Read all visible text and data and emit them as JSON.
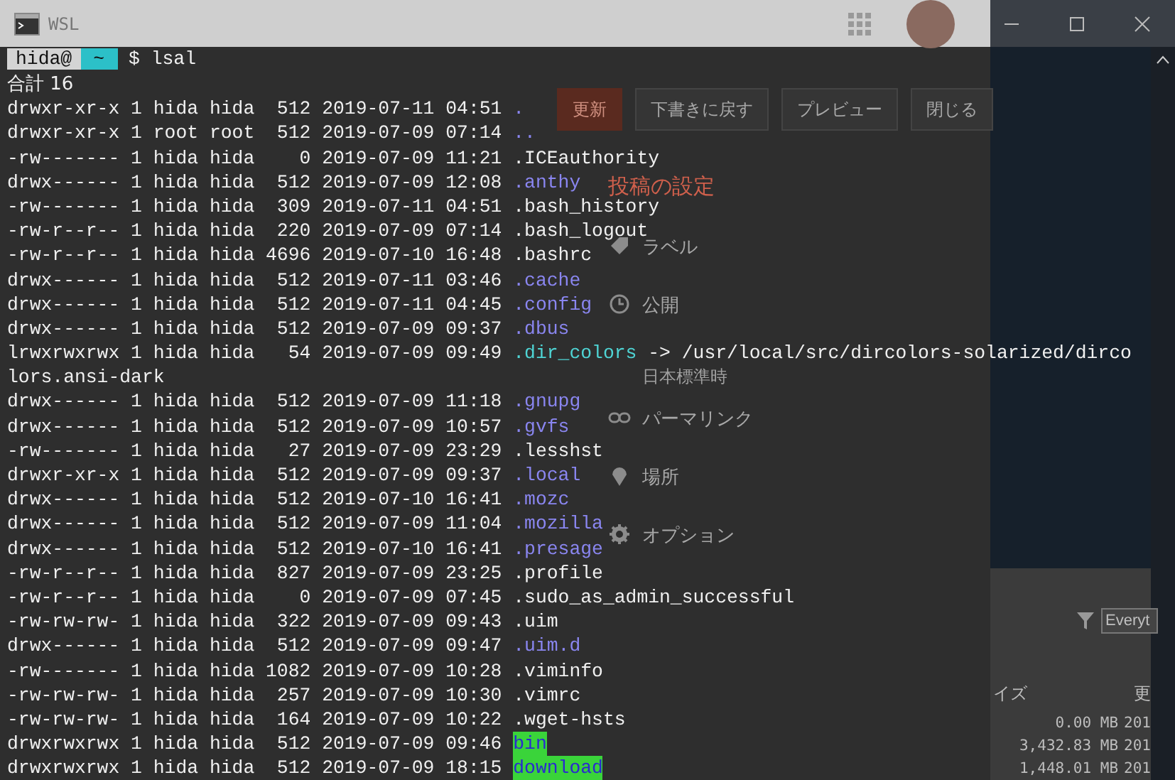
{
  "window": {
    "title": "WSL"
  },
  "background_editor": {
    "buttons": [
      {
        "label": "更新",
        "kind": "primary"
      },
      {
        "label": "下書きに戻す",
        "kind": "normal"
      },
      {
        "label": "プレビュー",
        "kind": "normal"
      },
      {
        "label": "閉じる",
        "kind": "normal"
      }
    ],
    "settings_heading": "投稿の設定",
    "settings": [
      {
        "kind": "labels",
        "label": "ラベル"
      },
      {
        "kind": "schedule",
        "label": "公開",
        "detail": "日本標準時"
      },
      {
        "kind": "permalink",
        "label": "パーマリンク"
      },
      {
        "kind": "location",
        "label": "場所"
      },
      {
        "kind": "options",
        "label": "オプション"
      }
    ]
  },
  "background_file_window": {
    "search_placeholder": "Everyt",
    "columns": [
      "イズ",
      "更"
    ],
    "rows": [
      {
        "size": "0.00 MB",
        "date": "201"
      },
      {
        "size": "3,432.83 MB",
        "date": "201"
      },
      {
        "size": "1,448.01 MB",
        "date": "201"
      }
    ]
  },
  "terminal": {
    "prompt": {
      "user": "hida@",
      "dir": "~",
      "command": "$ lsal"
    },
    "lines": [
      {
        "kind": "total",
        "text": "合計 16"
      },
      {
        "kind": "dir",
        "info": "drwxr-xr-x 1 hida hida  512 2019-07-11 04:51",
        "name": "."
      },
      {
        "kind": "dir",
        "info": "drwxr-xr-x 1 root root  512 2019-07-09 07:14",
        "name": ".."
      },
      {
        "kind": "file",
        "info": "-rw------- 1 hida hida    0 2019-07-09 11:21",
        "name": ".ICEauthority"
      },
      {
        "kind": "dir",
        "info": "drwx------ 1 hida hida  512 2019-07-09 12:08",
        "name": ".anthy"
      },
      {
        "kind": "file",
        "info": "-rw------- 1 hida hida  309 2019-07-11 04:51",
        "name": ".bash_history"
      },
      {
        "kind": "file",
        "info": "-rw-r--r-- 1 hida hida  220 2019-07-09 07:14",
        "name": ".bash_logout"
      },
      {
        "kind": "file",
        "info": "-rw-r--r-- 1 hida hida 4696 2019-07-10 16:48",
        "name": ".bashrc"
      },
      {
        "kind": "dir",
        "info": "drwx------ 1 hida hida  512 2019-07-11 03:46",
        "name": ".cache"
      },
      {
        "kind": "dir",
        "info": "drwx------ 1 hida hida  512 2019-07-11 04:45",
        "name": ".config"
      },
      {
        "kind": "dir",
        "info": "drwx------ 1 hida hida  512 2019-07-09 09:37",
        "name": ".dbus"
      },
      {
        "kind": "link",
        "info": "lrwxrwxrwx 1 hida hida   54 2019-07-09 09:49",
        "name": ".dir_colors",
        "target": "-> /usr/local/src/dircolors-solarized/dirco"
      },
      {
        "kind": "continuation",
        "text": "lors.ansi-dark"
      },
      {
        "kind": "dir",
        "info": "drwx------ 1 hida hida  512 2019-07-09 11:18",
        "name": ".gnupg"
      },
      {
        "kind": "dir",
        "info": "drwx------ 1 hida hida  512 2019-07-09 10:57",
        "name": ".gvfs"
      },
      {
        "kind": "file",
        "info": "-rw------- 1 hida hida   27 2019-07-09 23:29",
        "name": ".lesshst"
      },
      {
        "kind": "dir",
        "info": "drwxr-xr-x 1 hida hida  512 2019-07-09 09:37",
        "name": ".local"
      },
      {
        "kind": "dir",
        "info": "drwx------ 1 hida hida  512 2019-07-10 16:41",
        "name": ".mozc"
      },
      {
        "kind": "dir",
        "info": "drwx------ 1 hida hida  512 2019-07-09 11:04",
        "name": ".mozilla"
      },
      {
        "kind": "dir",
        "info": "drwx------ 1 hida hida  512 2019-07-10 16:41",
        "name": ".presage"
      },
      {
        "kind": "file",
        "info": "-rw-r--r-- 1 hida hida  827 2019-07-09 23:25",
        "name": ".profile"
      },
      {
        "kind": "file",
        "info": "-rw-r--r-- 1 hida hida    0 2019-07-09 07:45",
        "name": ".sudo_as_admin_successful"
      },
      {
        "kind": "file",
        "info": "-rw-rw-rw- 1 hida hida  322 2019-07-09 09:43",
        "name": ".uim"
      },
      {
        "kind": "dir",
        "info": "drwx------ 1 hida hida  512 2019-07-09 09:47",
        "name": ".uim.d"
      },
      {
        "kind": "file",
        "info": "-rw------- 1 hida hida 1082 2019-07-09 10:28",
        "name": ".viminfo"
      },
      {
        "kind": "file",
        "info": "-rw-rw-rw- 1 hida hida  257 2019-07-09 10:30",
        "name": ".vimrc"
      },
      {
        "kind": "file",
        "info": "-rw-rw-rw- 1 hida hida  164 2019-07-09 10:22",
        "name": ".wget-hsts"
      },
      {
        "kind": "writable_dir",
        "info": "drwxrwxrwx 1 hida hida  512 2019-07-09 09:46",
        "name": "bin"
      },
      {
        "kind": "writable_dir",
        "info": "drwxrwxrwx 1 hida hida  512 2019-07-09 18:15",
        "name": "download"
      }
    ]
  }
}
